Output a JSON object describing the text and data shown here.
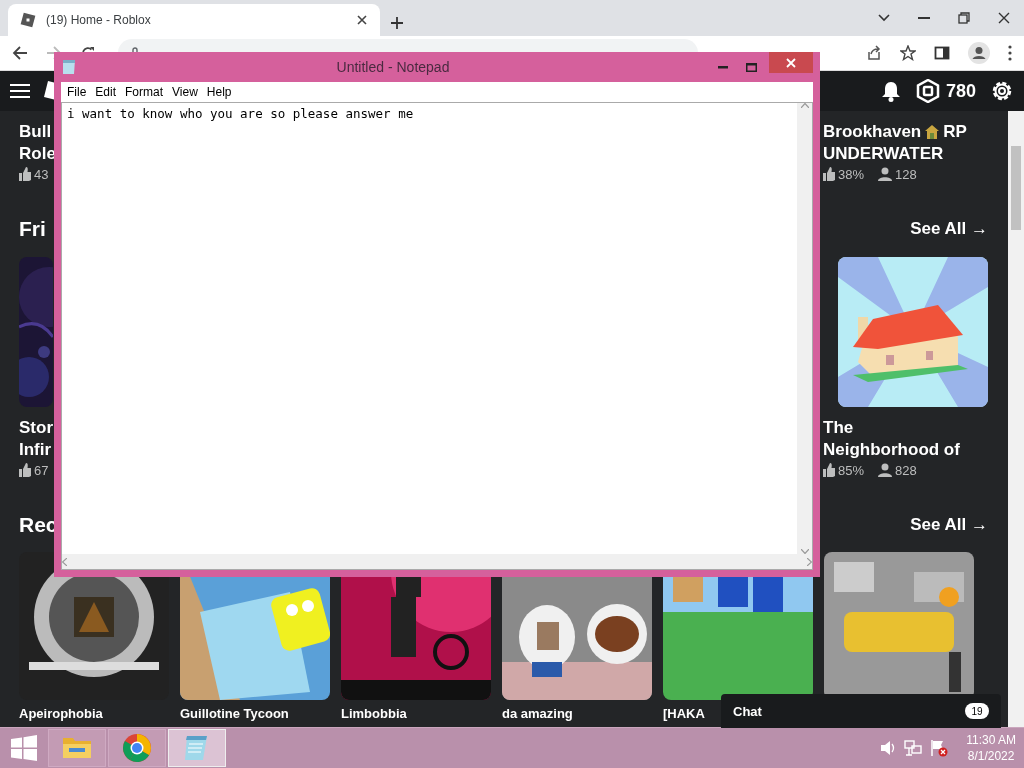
{
  "browser": {
    "tab": {
      "title": "(19) Home - Roblox"
    }
  },
  "header": {
    "robux": "780"
  },
  "top_games": {
    "left": {
      "title_lines": [
        "Bull",
        "Role"
      ],
      "likes": "43"
    },
    "right": {
      "title": "Brookhaven",
      "title_after_icon": "RP",
      "title_line2": "UNDERWATER",
      "likes": "38%",
      "players": "128"
    }
  },
  "friends_section": {
    "heading": "Fri",
    "see_all": "See All →",
    "left": {
      "title_lines": [
        "Stor",
        "Infir"
      ],
      "likes": "67"
    },
    "right": {
      "title_lines": [
        "The",
        "Neighborhood of"
      ],
      "likes": "85%",
      "players": "828"
    }
  },
  "recommended_section": {
    "heading": "Rec",
    "see_all": "See All →",
    "games": [
      {
        "title": "Apeirophobia",
        "kind": "dark"
      },
      {
        "title": "Guillotine Tycoon",
        "kind": "blocky"
      },
      {
        "title": "Limbobbia",
        "kind": "crimson"
      },
      {
        "title": "da amazing",
        "kind": "grey"
      },
      {
        "title": "[HAKA",
        "kind": "green"
      },
      {
        "kind": "mono"
      }
    ]
  },
  "notepad": {
    "title": "Untitled - Notepad",
    "menu": [
      "File",
      "Edit",
      "Format",
      "View",
      "Help"
    ],
    "text": "i want to know who you are so please answer me"
  },
  "chat": {
    "label": "Chat",
    "count": "19"
  },
  "taskbar": {
    "apps": [
      {
        "kind": "explorer",
        "selected": false
      },
      {
        "kind": "chrome",
        "selected": false
      },
      {
        "kind": "notepad",
        "selected": true
      }
    ],
    "time": "11:30 AM",
    "date": "8/1/2022"
  }
}
